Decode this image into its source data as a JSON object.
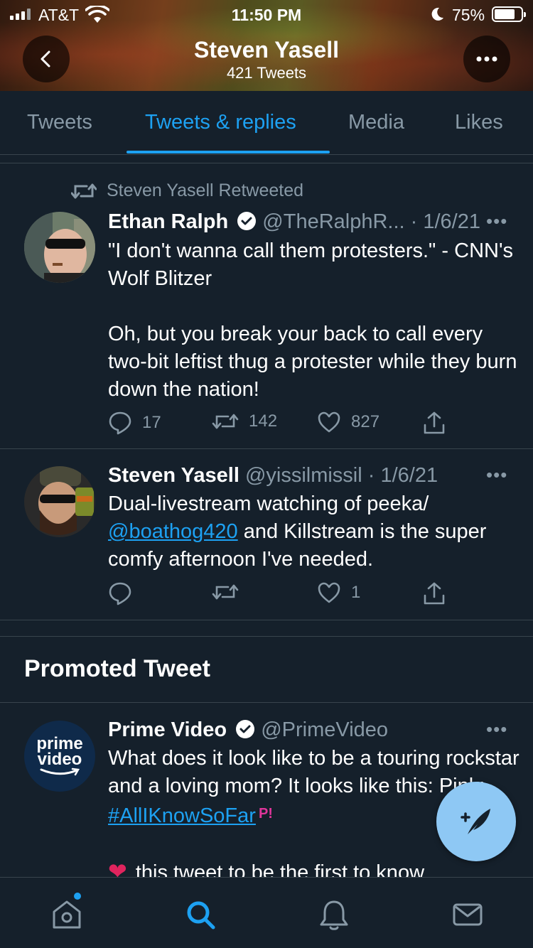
{
  "status_bar": {
    "carrier": "AT&T",
    "time": "11:50 PM",
    "battery": "75%"
  },
  "profile": {
    "name": "Steven Yasell",
    "tweet_count": "421 Tweets"
  },
  "tabs": [
    {
      "label": "Tweets"
    },
    {
      "label": "Tweets & replies"
    },
    {
      "label": "Media"
    },
    {
      "label": "Likes"
    }
  ],
  "tweets": [
    {
      "retweet_label": "Steven Yasell Retweeted",
      "name": "Ethan Ralph",
      "meta": "@TheRalphR... · 1/6/21",
      "body_line1": "\"I don't wanna call them protesters.\" - CNN's Wolf Blitzer",
      "body_line2": "Oh, but you break your back to call every two-bit leftist thug a protester while they burn down the nation!",
      "replies": "17",
      "retweets": "142",
      "likes": "827"
    },
    {
      "name": "Steven Yasell",
      "meta": "@yissilmissil · 1/6/21",
      "body_pre": "Dual-livestream watching of peeka/ ",
      "mention": "@boathog420",
      "body_post": " and Killstream is the super comfy afternoon I've needed.",
      "likes": "1"
    }
  ],
  "promoted": {
    "section_title": "Promoted Tweet",
    "name": "Prime Video",
    "handle": "@PrimeVideo",
    "avatar_text_1": "prime",
    "avatar_text_2": "video",
    "body_pre": "What does it look like to be a touring rockstar and a loving mom? It looks like this: Pink: ",
    "hashtag": "#AllIKnowSoFar",
    "body_line2": "this tweet to be the first to know"
  },
  "colors": {
    "background": "#15202b",
    "accent": "#1da1f2",
    "muted": "#8899a6"
  }
}
